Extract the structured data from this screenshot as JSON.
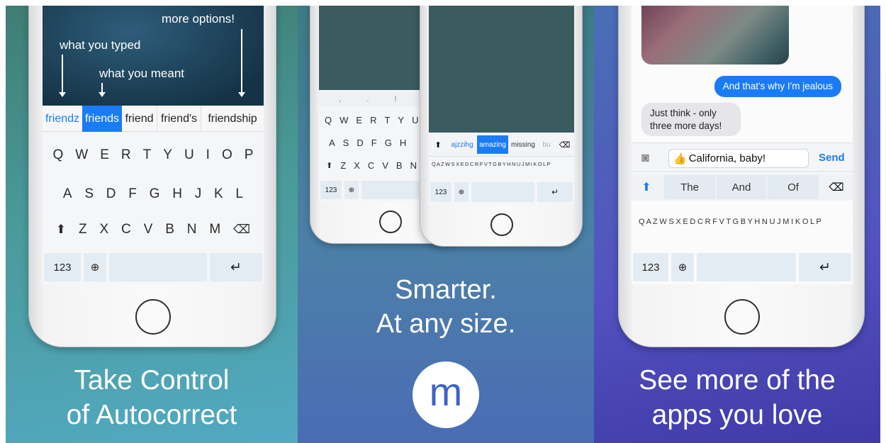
{
  "panel1": {
    "annotations": {
      "more_options": "more options!",
      "typed": "what you typed",
      "meant": "what you meant"
    },
    "suggestions": [
      {
        "text": "friendz",
        "state": "typed"
      },
      {
        "text": "friends",
        "state": "selected"
      },
      {
        "text": "friend",
        "state": "normal"
      },
      {
        "text": "friend's",
        "state": "normal"
      },
      {
        "text": "friendship",
        "state": "normal"
      }
    ],
    "keyboard": {
      "row1": [
        "Q",
        "W",
        "E",
        "R",
        "T",
        "Y",
        "U",
        "I",
        "O",
        "P"
      ],
      "row2": [
        "A",
        "S",
        "D",
        "F",
        "G",
        "H",
        "J",
        "K",
        "L"
      ],
      "row3": [
        "Z",
        "X",
        "C",
        "V",
        "B",
        "N",
        "M"
      ],
      "numbers_key": "123"
    },
    "caption_line1": "Take Control",
    "caption_line2": "of Autocorrect"
  },
  "panel2": {
    "left_phone": {
      "punct_row": [
        ",",
        ".",
        "!",
        "?"
      ],
      "row1": [
        "Q",
        "W",
        "E",
        "R",
        "T",
        "Y",
        "U"
      ],
      "row2": [
        "A",
        "S",
        "D",
        "F",
        "G",
        "H"
      ],
      "row3": [
        "Z",
        "X",
        "C",
        "V",
        "B",
        "N"
      ],
      "numbers_key": "123"
    },
    "right_phone": {
      "suggestions": [
        {
          "text": "ajzzihg",
          "state": "typed"
        },
        {
          "text": "amazing",
          "state": "selected"
        },
        {
          "text": "missing",
          "state": "normal"
        },
        {
          "text": "bu",
          "state": "normal"
        }
      ],
      "compact_row": "Q A Z W S X E D C R F V T G B Y H N U J M I K O L P",
      "numbers_key": "123"
    },
    "caption_line1": "Smarter.",
    "caption_line2": "At any size.",
    "logo_letter": "m"
  },
  "panel3": {
    "messages": [
      {
        "text": "And that's why I'm jealous",
        "from": "me"
      },
      {
        "text": "Just think - only three more days!",
        "from": "them"
      }
    ],
    "input": {
      "emoji": "👍",
      "value": "California, baby!"
    },
    "send_label": "Send",
    "suggestions": [
      "The",
      "And",
      "Of"
    ],
    "compact_row": "Q A Z W S X E D C R F V T G B Y H N U J M I K O L P",
    "numbers_key": "123",
    "caption_line1": "See more of the",
    "caption_line2": "apps you love"
  },
  "colors": {
    "accent": "#1a7cf5",
    "bubble_me": "#1a7cf5",
    "bubble_them": "#e5e5ea"
  }
}
